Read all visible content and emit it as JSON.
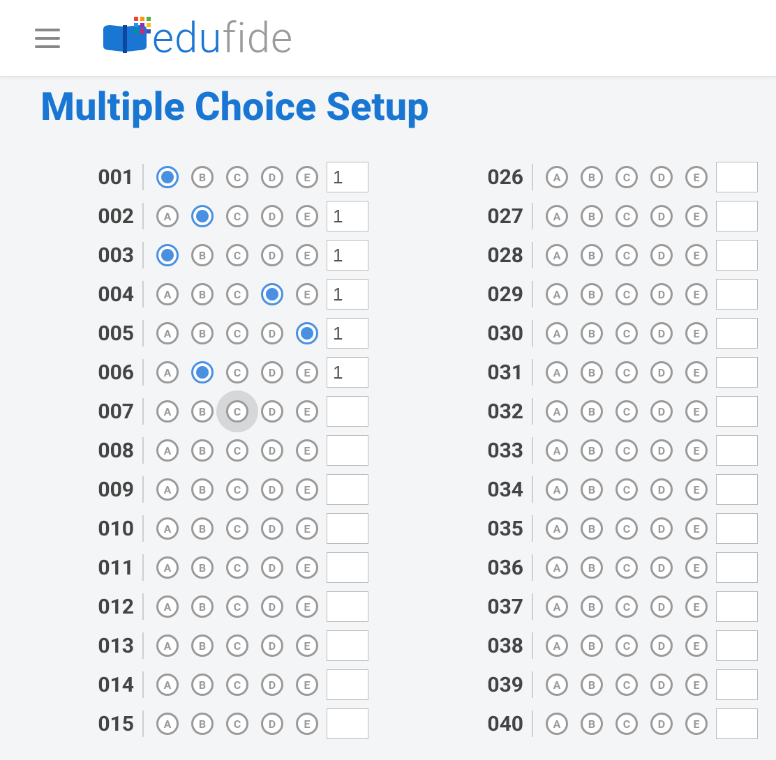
{
  "header": {
    "brand_edu": "edu",
    "brand_fide": "fide"
  },
  "page": {
    "title": "Multiple Choice Setup"
  },
  "options": [
    "A",
    "B",
    "C",
    "D",
    "E"
  ],
  "leftStart": 1,
  "rightStart": 26,
  "rowsPerCol": 15,
  "questions": {
    "001": {
      "selected": "A",
      "points": "1"
    },
    "002": {
      "selected": "B",
      "points": "1"
    },
    "003": {
      "selected": "A",
      "points": "1"
    },
    "004": {
      "selected": "D",
      "points": "1"
    },
    "005": {
      "selected": "E",
      "points": "1"
    },
    "006": {
      "selected": "B",
      "points": "1"
    },
    "007": {
      "selected": null,
      "points": "",
      "pressed": "C"
    },
    "008": {
      "selected": null,
      "points": ""
    },
    "009": {
      "selected": null,
      "points": ""
    },
    "010": {
      "selected": null,
      "points": ""
    },
    "011": {
      "selected": null,
      "points": ""
    },
    "012": {
      "selected": null,
      "points": ""
    },
    "013": {
      "selected": null,
      "points": ""
    },
    "014": {
      "selected": null,
      "points": ""
    },
    "015": {
      "selected": null,
      "points": ""
    },
    "026": {
      "selected": null,
      "points": ""
    },
    "027": {
      "selected": null,
      "points": ""
    },
    "028": {
      "selected": null,
      "points": ""
    },
    "029": {
      "selected": null,
      "points": ""
    },
    "030": {
      "selected": null,
      "points": ""
    },
    "031": {
      "selected": null,
      "points": ""
    },
    "032": {
      "selected": null,
      "points": ""
    },
    "033": {
      "selected": null,
      "points": ""
    },
    "034": {
      "selected": null,
      "points": ""
    },
    "035": {
      "selected": null,
      "points": ""
    },
    "036": {
      "selected": null,
      "points": ""
    },
    "037": {
      "selected": null,
      "points": ""
    },
    "038": {
      "selected": null,
      "points": ""
    },
    "039": {
      "selected": null,
      "points": ""
    },
    "040": {
      "selected": null,
      "points": ""
    }
  }
}
